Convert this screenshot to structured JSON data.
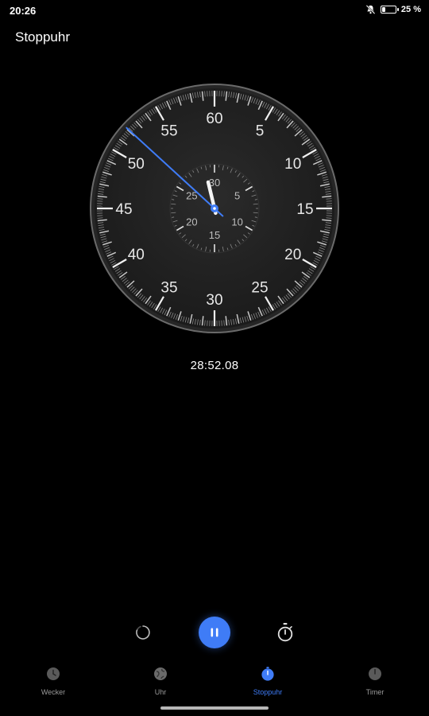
{
  "status_bar": {
    "time": "20:26",
    "battery_percent": "25 %",
    "battery_level": 0.25
  },
  "page_title": "Stoppuhr",
  "dial": {
    "outer_labels": [
      "60",
      "5",
      "10",
      "15",
      "20",
      "25",
      "30",
      "35",
      "40",
      "45",
      "50",
      "55"
    ],
    "inner_labels": [
      "30",
      "5",
      "10",
      "15",
      "20",
      "25"
    ],
    "second_hand_seconds": 52.08,
    "minute_hand_minutes": 28.87,
    "accent_color": "#3f7cf6"
  },
  "elapsed_time": "28:52.08",
  "controls": {
    "reset_icon": "reset-spinner-icon",
    "pause_icon": "pause-icon",
    "lap_icon": "stopwatch-lap-icon"
  },
  "nav": [
    {
      "label": "Wecker",
      "icon": "alarm-icon",
      "active": false
    },
    {
      "label": "Uhr",
      "icon": "world-clock-icon",
      "active": false
    },
    {
      "label": "Stoppuhr",
      "icon": "stopwatch-icon",
      "active": true
    },
    {
      "label": "Timer",
      "icon": "timer-icon",
      "active": false
    }
  ]
}
